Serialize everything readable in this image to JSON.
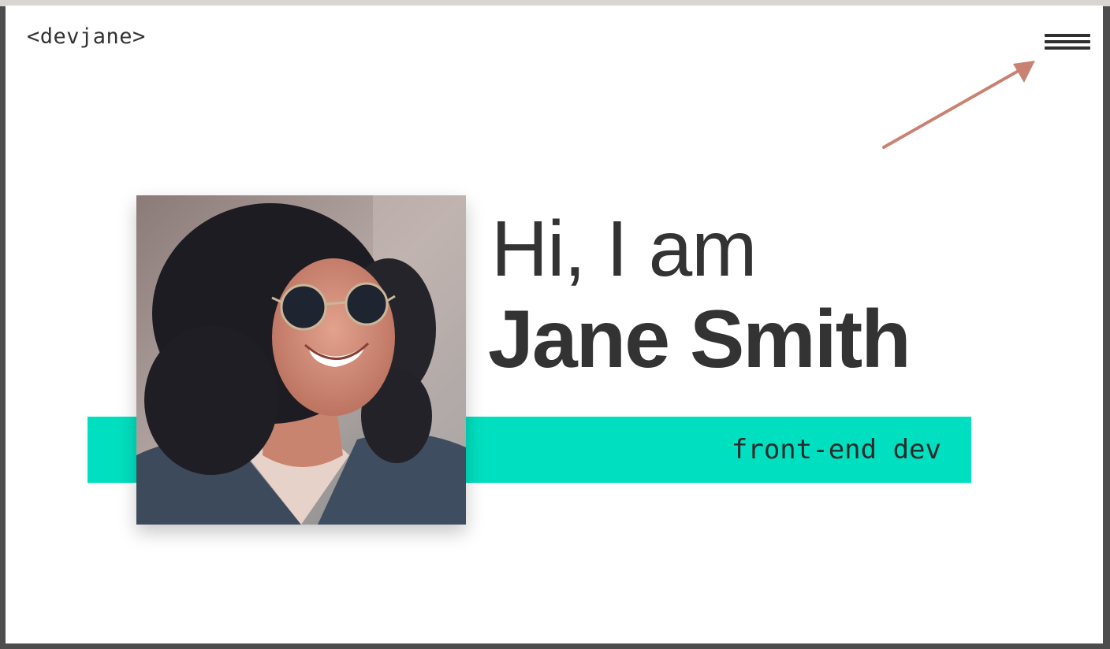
{
  "header": {
    "logo_text": "<devjane>",
    "menu_icon": "hamburger-menu-icon"
  },
  "hero": {
    "greeting": "Hi, I am",
    "name": "Jane Smith",
    "tagline": "front-end dev",
    "photo_icon": "profile-photo"
  },
  "colors": {
    "accent": "#00dfbf",
    "text": "#333333",
    "annotation_arrow": "#c98272",
    "background": "#ffffff"
  }
}
